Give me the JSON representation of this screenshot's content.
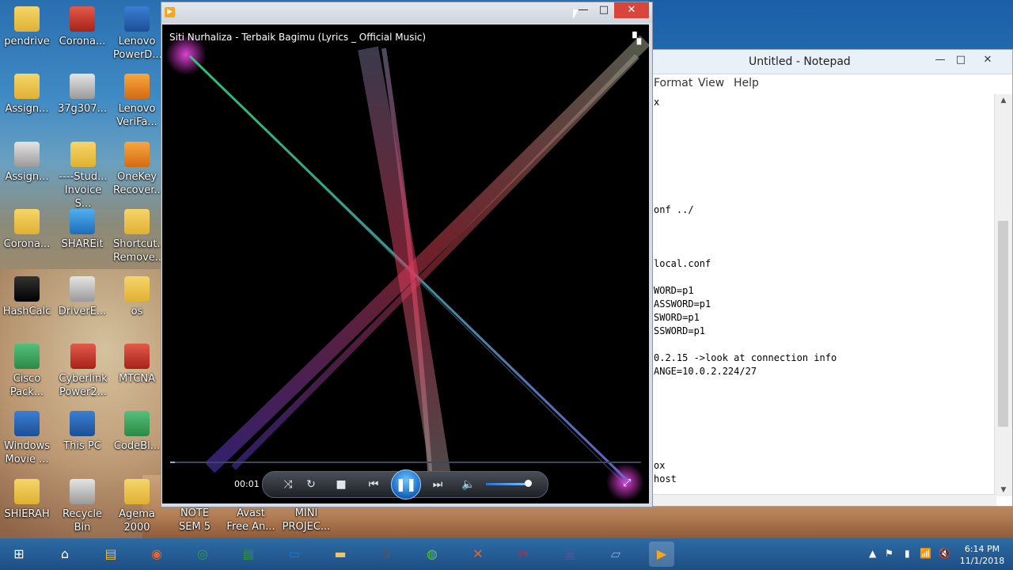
{
  "desktop": {
    "icons": [
      {
        "label": "pendrive",
        "icon": "folder-icon"
      },
      {
        "label": "Corona...",
        "icon": "winrar-icon"
      },
      {
        "label": "Lenovo PowerD...",
        "icon": "lenovo-power-icon"
      },
      {
        "label": "Assign...",
        "icon": "folder-icon"
      },
      {
        "label": "37g307...",
        "icon": "shortcut-icon"
      },
      {
        "label": "Lenovo VeriFa...",
        "icon": "lenovo-verifa-icon"
      },
      {
        "label": "Assign...",
        "icon": "video-icon"
      },
      {
        "label": "----Stud... Invoice S...",
        "icon": "folder-icon"
      },
      {
        "label": "OneKey Recover...",
        "icon": "onekey-icon"
      },
      {
        "label": "Corona...",
        "icon": "folder-icon"
      },
      {
        "label": "SHAREit",
        "icon": "shareit-icon"
      },
      {
        "label": "Shortcut... Remove...",
        "icon": "folder-icon"
      },
      {
        "label": "HashCalc",
        "icon": "hashcalc-icon"
      },
      {
        "label": "DriverE...",
        "icon": "driver-icon"
      },
      {
        "label": "os",
        "icon": "folder-icon"
      },
      {
        "label": "Cisco Pack...",
        "icon": "cisco-icon"
      },
      {
        "label": "Cyberlink Power2...",
        "icon": "cyberlink-icon"
      },
      {
        "label": "MTCNA",
        "icon": "pdf-icon"
      },
      {
        "label": "Windows Movie ...",
        "icon": "movie-icon"
      },
      {
        "label": "This PC",
        "icon": "this-pc-icon"
      },
      {
        "label": "CodeBl...",
        "icon": "codeblocks-icon"
      },
      {
        "label": "SHIERAH",
        "icon": "folder-icon"
      },
      {
        "label": "Recycle Bin",
        "icon": "recycle-bin-icon"
      },
      {
        "label": "Agema 2000",
        "icon": "folder-icon"
      },
      {
        "label": "NOTE SEM 5",
        "icon": "folder-icon"
      },
      {
        "label": "Avast Free An...",
        "icon": "avast-icon"
      },
      {
        "label": "MINI PROJEC...",
        "icon": "folder-icon"
      }
    ]
  },
  "player": {
    "now_playing": "Siti Nurhaliza - Terbaik Bagimu (Lyrics _ Official Music)",
    "time": "00:01",
    "progress": 0.01,
    "volume": 0.9,
    "min_glyph": "—",
    "max_glyph": "□",
    "close_glyph": "✕",
    "view_glyph": "▚",
    "mini_glyph": "⤢"
  },
  "notepad": {
    "title": "Untitled - Notepad",
    "min_glyph": "—",
    "max_glyph": "□",
    "close_glyph": "✕",
    "menu": [
      "Format",
      "View",
      "Help"
    ],
    "lines": [
      {
        "text": "x",
        "row": 0
      },
      {
        "text": "onf ../",
        "row": 8
      },
      {
        "text": "local.conf",
        "row": 12
      },
      {
        "text": "WORD=p1",
        "row": 14
      },
      {
        "text": "ASSWORD=p1",
        "row": 15
      },
      {
        "text": "SWORD=p1",
        "row": 16
      },
      {
        "text": "SSWORD=p1",
        "row": 17
      },
      {
        "text": "0.2.15 ->look at connection info",
        "row": 19
      },
      {
        "text": "ANGE=10.0.2.224/27",
        "row": 20
      },
      {
        "text": "ox",
        "row": 27
      },
      {
        "text": "host",
        "row": 28
      }
    ]
  },
  "taskbar": {
    "apps": [
      "windows-start-icon",
      "home-icon",
      "file-explorer-icon",
      "firefox-icon",
      "chrome-icon",
      "excel-icon",
      "terminal-icon",
      "folder-icon",
      "sublime-icon",
      "greenshot-icon",
      "xampp-icon",
      "snipping-icon",
      "virtualbox-icon",
      "notepad-icon",
      "media-player-icon"
    ],
    "clock_time": "6:14 PM",
    "clock_date": "11/1/2018"
  }
}
